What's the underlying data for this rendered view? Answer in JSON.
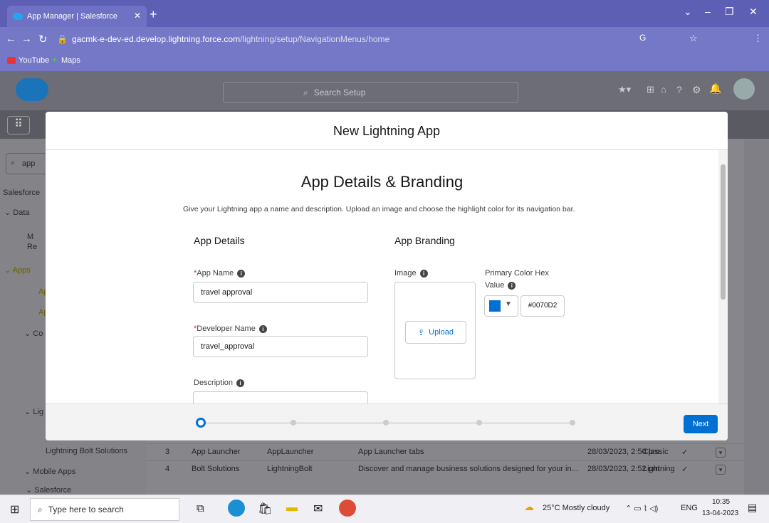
{
  "browser": {
    "tab_title": "App Manager | Salesforce",
    "url_host": "gacmk-e-dev-ed.develop.lightning.force.com",
    "url_path": "/lightning/setup/NavigationMenus/home",
    "bookmarks": [
      "YouTube",
      "Maps"
    ]
  },
  "header": {
    "search_placeholder": "Search Setup"
  },
  "sidebar": {
    "search_value": "app",
    "items": [
      "Salesforce",
      "Data",
      "M",
      "Re",
      "Apps",
      "Ap",
      "Ap",
      "Co",
      "Lig",
      "Lightning Bolt Solutions",
      "Mobile Apps",
      "Salesforce"
    ]
  },
  "bg_table": {
    "rows": [
      {
        "num": "3",
        "name": "App Launcher",
        "dev": "AppLauncher",
        "desc": "App Launcher tabs",
        "date": "28/03/2023, 2:50 pm",
        "type": "Classic"
      },
      {
        "num": "4",
        "name": "Bolt Solutions",
        "dev": "LightningBolt",
        "desc": "Discover and manage business solutions designed for your in...",
        "date": "28/03/2023, 2:52 pm",
        "type": "Lightning"
      }
    ]
  },
  "modal": {
    "title": "New Lightning App",
    "heading": "App Details & Branding",
    "description": "Give your Lightning app a name and description. Upload an image and choose the highlight color for its navigation bar.",
    "app_details_title": "App Details",
    "app_branding_title": "App Branding",
    "app_name_label": "App Name",
    "app_name_value": "travel  approval",
    "dev_name_label": "Developer Name",
    "dev_name_value": "travel_approval",
    "description_label": "Description",
    "image_label": "Image",
    "upload_label": "Upload",
    "color_label_1": "Primary Color Hex",
    "color_label_2": "Value",
    "color_value": "#0070D2",
    "next_label": "Next",
    "required_mark": "*"
  },
  "taskbar": {
    "search_placeholder": "Type here to search",
    "weather": "25°C  Mostly cloudy",
    "lang": "ENG",
    "time": "10:35",
    "date": "13-04-2023"
  },
  "colors": {
    "accent": "#0070d2",
    "tabbar": "#5c5fb4"
  }
}
